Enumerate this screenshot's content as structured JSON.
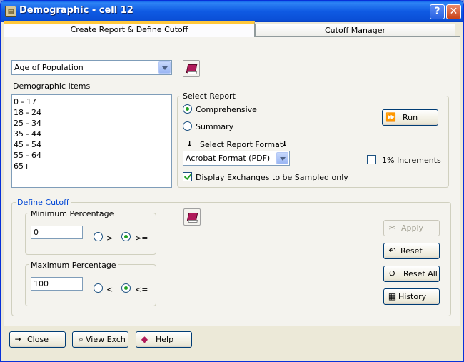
{
  "window": {
    "title": "Demographic - cell 12",
    "help_glyph": "?",
    "close_glyph": "✕"
  },
  "tabs": [
    {
      "label": "Create Report & Define Cutoff",
      "active": true
    },
    {
      "label": "Cutoff Manager",
      "active": false
    }
  ],
  "demographic": {
    "selected": "Age of Population",
    "items_label": "Demographic Items",
    "items": [
      "0  - 17",
      "18 - 24",
      "25 - 34",
      "35 - 44",
      "45 - 54",
      "55 - 64",
      "65+"
    ]
  },
  "select_report": {
    "title": "Select Report",
    "options": [
      {
        "label": "Comprehensive",
        "selected": true
      },
      {
        "label": "Summary",
        "selected": false
      }
    ],
    "format_label": "Select Report Format",
    "format_value": "Acrobat Format (PDF)",
    "display_exchanges_label": "Display  Exchanges to be Sampled only",
    "display_exchanges_checked": true,
    "run_label": "Run",
    "increments_label": "1%  Increments",
    "increments_checked": false
  },
  "define_cutoff": {
    "title": "Define Cutoff",
    "minimum": {
      "title": "Minimum Percentage",
      "value": "0",
      "options": [
        {
          "label": ">",
          "selected": false
        },
        {
          "label": ">=",
          "selected": true
        }
      ]
    },
    "maximum": {
      "title": "Maximum Percentage",
      "value": "100",
      "options": [
        {
          "label": "<",
          "selected": false
        },
        {
          "label": "<=",
          "selected": true
        }
      ]
    },
    "buttons": {
      "apply": "Apply",
      "reset": "Reset",
      "reset_all": "Reset All",
      "history": "History"
    }
  },
  "footer": {
    "close": "Close",
    "view_exch": "View Exch",
    "help": "Help"
  },
  "colors": {
    "titlebar": "#0a5fe8",
    "tab_highlight": "#ffc83c",
    "group_title": "#0046d5",
    "radio_dot": "#21a121"
  }
}
